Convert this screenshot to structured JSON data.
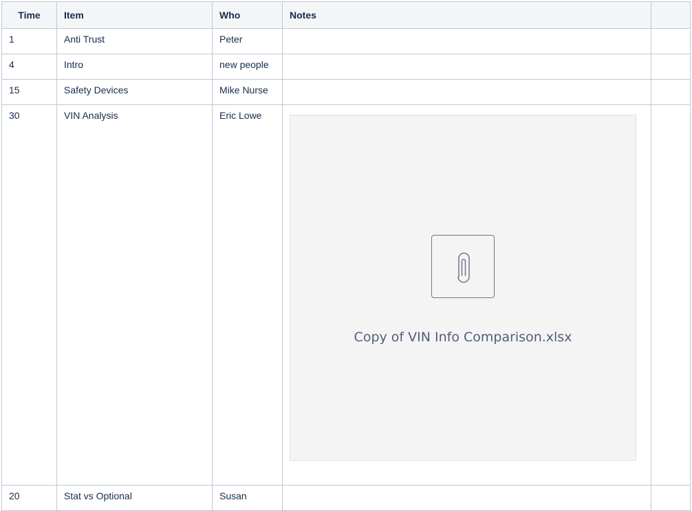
{
  "table": {
    "headers": {
      "time": "Time",
      "item": "Item",
      "who": "Who",
      "notes": "Notes",
      "extra": ""
    },
    "rows": [
      {
        "time": "1",
        "item": "Anti Trust",
        "who": "Peter",
        "notes": "",
        "extra": ""
      },
      {
        "time": "4",
        "item": "Intro",
        "who": "new people",
        "notes": "",
        "extra": ""
      },
      {
        "time": "15",
        "item": "Safety Devices",
        "who": "Mike Nurse",
        "notes": "",
        "extra": ""
      },
      {
        "time": "30",
        "item": "VIN Analysis",
        "who": "Eric Lowe",
        "notes": "",
        "extra": "",
        "attachment": {
          "filename": "Copy of VIN Info Comparison.xlsx",
          "icon": "paperclip-icon"
        }
      },
      {
        "time": "20",
        "item": "Stat vs Optional",
        "who": "Susan",
        "notes": "",
        "extra": ""
      }
    ]
  },
  "colors": {
    "border": "#c1c7d0",
    "header_bg": "#f4f5f7",
    "attachment_bg": "#f4f4f4",
    "text": "#172b4d"
  }
}
